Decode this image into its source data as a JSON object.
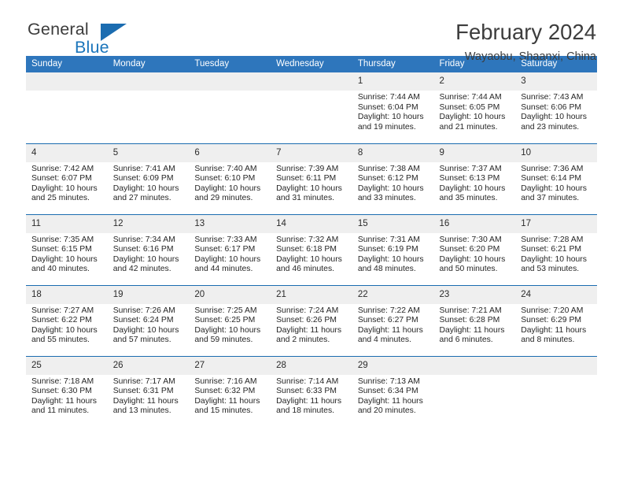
{
  "brand": {
    "name_part1": "General",
    "name_part2": "Blue",
    "logo_icon": "triangle-logo-icon",
    "accent_color": "#1b6cb0"
  },
  "header": {
    "month_title": "February 2024",
    "location": "Wayaobu, Shaanxi, China"
  },
  "calendar": {
    "header_background": "#2e76bc",
    "daynum_background": "#efefef",
    "row_separator_color": "#1b6cb0",
    "weekday_headers": [
      "Sunday",
      "Monday",
      "Tuesday",
      "Wednesday",
      "Thursday",
      "Friday",
      "Saturday"
    ],
    "weeks": [
      [
        {
          "day": "",
          "sunrise": "",
          "sunset": "",
          "daylight_line1": "",
          "daylight_line2": ""
        },
        {
          "day": "",
          "sunrise": "",
          "sunset": "",
          "daylight_line1": "",
          "daylight_line2": ""
        },
        {
          "day": "",
          "sunrise": "",
          "sunset": "",
          "daylight_line1": "",
          "daylight_line2": ""
        },
        {
          "day": "",
          "sunrise": "",
          "sunset": "",
          "daylight_line1": "",
          "daylight_line2": ""
        },
        {
          "day": "1",
          "sunrise": "Sunrise: 7:44 AM",
          "sunset": "Sunset: 6:04 PM",
          "daylight_line1": "Daylight: 10 hours",
          "daylight_line2": "and 19 minutes."
        },
        {
          "day": "2",
          "sunrise": "Sunrise: 7:44 AM",
          "sunset": "Sunset: 6:05 PM",
          "daylight_line1": "Daylight: 10 hours",
          "daylight_line2": "and 21 minutes."
        },
        {
          "day": "3",
          "sunrise": "Sunrise: 7:43 AM",
          "sunset": "Sunset: 6:06 PM",
          "daylight_line1": "Daylight: 10 hours",
          "daylight_line2": "and 23 minutes."
        }
      ],
      [
        {
          "day": "4",
          "sunrise": "Sunrise: 7:42 AM",
          "sunset": "Sunset: 6:07 PM",
          "daylight_line1": "Daylight: 10 hours",
          "daylight_line2": "and 25 minutes."
        },
        {
          "day": "5",
          "sunrise": "Sunrise: 7:41 AM",
          "sunset": "Sunset: 6:09 PM",
          "daylight_line1": "Daylight: 10 hours",
          "daylight_line2": "and 27 minutes."
        },
        {
          "day": "6",
          "sunrise": "Sunrise: 7:40 AM",
          "sunset": "Sunset: 6:10 PM",
          "daylight_line1": "Daylight: 10 hours",
          "daylight_line2": "and 29 minutes."
        },
        {
          "day": "7",
          "sunrise": "Sunrise: 7:39 AM",
          "sunset": "Sunset: 6:11 PM",
          "daylight_line1": "Daylight: 10 hours",
          "daylight_line2": "and 31 minutes."
        },
        {
          "day": "8",
          "sunrise": "Sunrise: 7:38 AM",
          "sunset": "Sunset: 6:12 PM",
          "daylight_line1": "Daylight: 10 hours",
          "daylight_line2": "and 33 minutes."
        },
        {
          "day": "9",
          "sunrise": "Sunrise: 7:37 AM",
          "sunset": "Sunset: 6:13 PM",
          "daylight_line1": "Daylight: 10 hours",
          "daylight_line2": "and 35 minutes."
        },
        {
          "day": "10",
          "sunrise": "Sunrise: 7:36 AM",
          "sunset": "Sunset: 6:14 PM",
          "daylight_line1": "Daylight: 10 hours",
          "daylight_line2": "and 37 minutes."
        }
      ],
      [
        {
          "day": "11",
          "sunrise": "Sunrise: 7:35 AM",
          "sunset": "Sunset: 6:15 PM",
          "daylight_line1": "Daylight: 10 hours",
          "daylight_line2": "and 40 minutes."
        },
        {
          "day": "12",
          "sunrise": "Sunrise: 7:34 AM",
          "sunset": "Sunset: 6:16 PM",
          "daylight_line1": "Daylight: 10 hours",
          "daylight_line2": "and 42 minutes."
        },
        {
          "day": "13",
          "sunrise": "Sunrise: 7:33 AM",
          "sunset": "Sunset: 6:17 PM",
          "daylight_line1": "Daylight: 10 hours",
          "daylight_line2": "and 44 minutes."
        },
        {
          "day": "14",
          "sunrise": "Sunrise: 7:32 AM",
          "sunset": "Sunset: 6:18 PM",
          "daylight_line1": "Daylight: 10 hours",
          "daylight_line2": "and 46 minutes."
        },
        {
          "day": "15",
          "sunrise": "Sunrise: 7:31 AM",
          "sunset": "Sunset: 6:19 PM",
          "daylight_line1": "Daylight: 10 hours",
          "daylight_line2": "and 48 minutes."
        },
        {
          "day": "16",
          "sunrise": "Sunrise: 7:30 AM",
          "sunset": "Sunset: 6:20 PM",
          "daylight_line1": "Daylight: 10 hours",
          "daylight_line2": "and 50 minutes."
        },
        {
          "day": "17",
          "sunrise": "Sunrise: 7:28 AM",
          "sunset": "Sunset: 6:21 PM",
          "daylight_line1": "Daylight: 10 hours",
          "daylight_line2": "and 53 minutes."
        }
      ],
      [
        {
          "day": "18",
          "sunrise": "Sunrise: 7:27 AM",
          "sunset": "Sunset: 6:22 PM",
          "daylight_line1": "Daylight: 10 hours",
          "daylight_line2": "and 55 minutes."
        },
        {
          "day": "19",
          "sunrise": "Sunrise: 7:26 AM",
          "sunset": "Sunset: 6:24 PM",
          "daylight_line1": "Daylight: 10 hours",
          "daylight_line2": "and 57 minutes."
        },
        {
          "day": "20",
          "sunrise": "Sunrise: 7:25 AM",
          "sunset": "Sunset: 6:25 PM",
          "daylight_line1": "Daylight: 10 hours",
          "daylight_line2": "and 59 minutes."
        },
        {
          "day": "21",
          "sunrise": "Sunrise: 7:24 AM",
          "sunset": "Sunset: 6:26 PM",
          "daylight_line1": "Daylight: 11 hours",
          "daylight_line2": "and 2 minutes."
        },
        {
          "day": "22",
          "sunrise": "Sunrise: 7:22 AM",
          "sunset": "Sunset: 6:27 PM",
          "daylight_line1": "Daylight: 11 hours",
          "daylight_line2": "and 4 minutes."
        },
        {
          "day": "23",
          "sunrise": "Sunrise: 7:21 AM",
          "sunset": "Sunset: 6:28 PM",
          "daylight_line1": "Daylight: 11 hours",
          "daylight_line2": "and 6 minutes."
        },
        {
          "day": "24",
          "sunrise": "Sunrise: 7:20 AM",
          "sunset": "Sunset: 6:29 PM",
          "daylight_line1": "Daylight: 11 hours",
          "daylight_line2": "and 8 minutes."
        }
      ],
      [
        {
          "day": "25",
          "sunrise": "Sunrise: 7:18 AM",
          "sunset": "Sunset: 6:30 PM",
          "daylight_line1": "Daylight: 11 hours",
          "daylight_line2": "and 11 minutes."
        },
        {
          "day": "26",
          "sunrise": "Sunrise: 7:17 AM",
          "sunset": "Sunset: 6:31 PM",
          "daylight_line1": "Daylight: 11 hours",
          "daylight_line2": "and 13 minutes."
        },
        {
          "day": "27",
          "sunrise": "Sunrise: 7:16 AM",
          "sunset": "Sunset: 6:32 PM",
          "daylight_line1": "Daylight: 11 hours",
          "daylight_line2": "and 15 minutes."
        },
        {
          "day": "28",
          "sunrise": "Sunrise: 7:14 AM",
          "sunset": "Sunset: 6:33 PM",
          "daylight_line1": "Daylight: 11 hours",
          "daylight_line2": "and 18 minutes."
        },
        {
          "day": "29",
          "sunrise": "Sunrise: 7:13 AM",
          "sunset": "Sunset: 6:34 PM",
          "daylight_line1": "Daylight: 11 hours",
          "daylight_line2": "and 20 minutes."
        },
        {
          "day": "",
          "sunrise": "",
          "sunset": "",
          "daylight_line1": "",
          "daylight_line2": ""
        },
        {
          "day": "",
          "sunrise": "",
          "sunset": "",
          "daylight_line1": "",
          "daylight_line2": ""
        }
      ]
    ]
  }
}
